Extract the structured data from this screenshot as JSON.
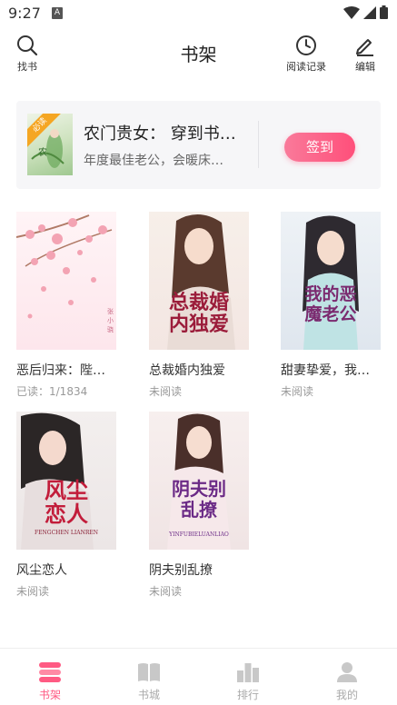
{
  "status_bar": {
    "time": "9:27",
    "notif_icon": "A"
  },
  "header": {
    "title": "书架",
    "search_label": "找书",
    "history_label": "阅读记录",
    "edit_label": "编辑"
  },
  "promo": {
    "title": "农门贵女： 穿到书…",
    "subtitle": "年度最佳老公，会暖床…",
    "badge": "必读",
    "signin_label": "签到"
  },
  "books": [
    {
      "title": "恶后归来：陛…",
      "status": "已读：1/1834"
    },
    {
      "title": "总裁婚内独爱",
      "status": "未阅读",
      "cover_text": "总裁婚内独爱"
    },
    {
      "title": "甜妻挚爱，我…",
      "status": "未阅读",
      "cover_text": "我的恶魔老公"
    },
    {
      "title": "风尘恋人",
      "status": "未阅读",
      "cover_text": "风尘恋人",
      "cover_sub": "FENGCHEN LIANREN"
    },
    {
      "title": "阴夫别乱撩",
      "status": "未阅读",
      "cover_text": "阴夫别乱撩",
      "cover_sub": "YINFUBIELUANLIAO"
    }
  ],
  "nav": [
    {
      "label": "书架",
      "active": true
    },
    {
      "label": "书城",
      "active": false
    },
    {
      "label": "排行",
      "active": false
    },
    {
      "label": "我的",
      "active": false
    }
  ],
  "colors": {
    "accent": "#ff5a83",
    "inactive": "#aaaaaa"
  }
}
